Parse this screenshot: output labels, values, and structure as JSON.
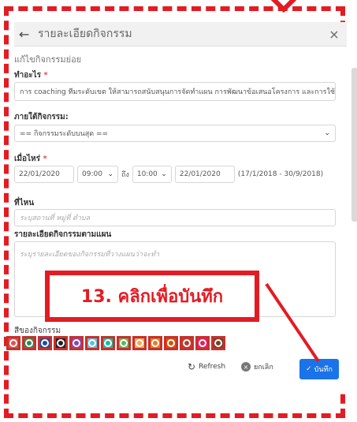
{
  "modal": {
    "title": "รายละเอียดกิจกรรม",
    "subtitle": "แก้ไขกิจกรรมย่อย"
  },
  "form": {
    "what": {
      "label": "ทำอะไร",
      "required_mark": "*",
      "value": "การ coaching ทีมระดับเขต ให้สามารถสนับสนุนการจัดทำแผน การพัฒนาข้อเสนอโครงการ และการใช้"
    },
    "under": {
      "label": "ภายใต้กิจกรรม:",
      "selected": "== กิจกรรมระดับบนสุด =="
    },
    "when": {
      "label": "เมื่อไหร่",
      "required_mark": "*",
      "start_date": "22/01/2020",
      "start_time": "09:00",
      "to_text": "ถึง",
      "end_time": "10:00",
      "end_date": "22/01/2020",
      "range_note": "(17/1/2018 - 30/9/2018)"
    },
    "where": {
      "label": "ที่ไหน",
      "placeholder": "ระบุสถานที่ หมู่ที่ ตำบล"
    },
    "detail": {
      "label": "รายละเอียดกิจกรรมตามแผน",
      "placeholder": "ระบุรายละเอียดของกิจกรรมที่วางแผนว่าจะทำ"
    },
    "color": {
      "label": "สีของกิจกรรม",
      "swatches": [
        "#d9534f",
        "#2e8b57",
        "#1f4e9c",
        "#222222",
        "#8e44ad",
        "#5bc0de",
        "#1abc9c",
        "#5cb85c",
        "#f0ad4e",
        "#e67e22",
        "#d35400",
        "#c0392b",
        "#e91e63",
        "#7b3f2a"
      ]
    }
  },
  "footer": {
    "refresh_label": "Refresh",
    "cancel_label": "ยกเลิก",
    "save_label": "บันทึก"
  },
  "annotation": {
    "callout_text": "13. คลิกเพื่อบันทึก",
    "accent": "#e31b23"
  }
}
